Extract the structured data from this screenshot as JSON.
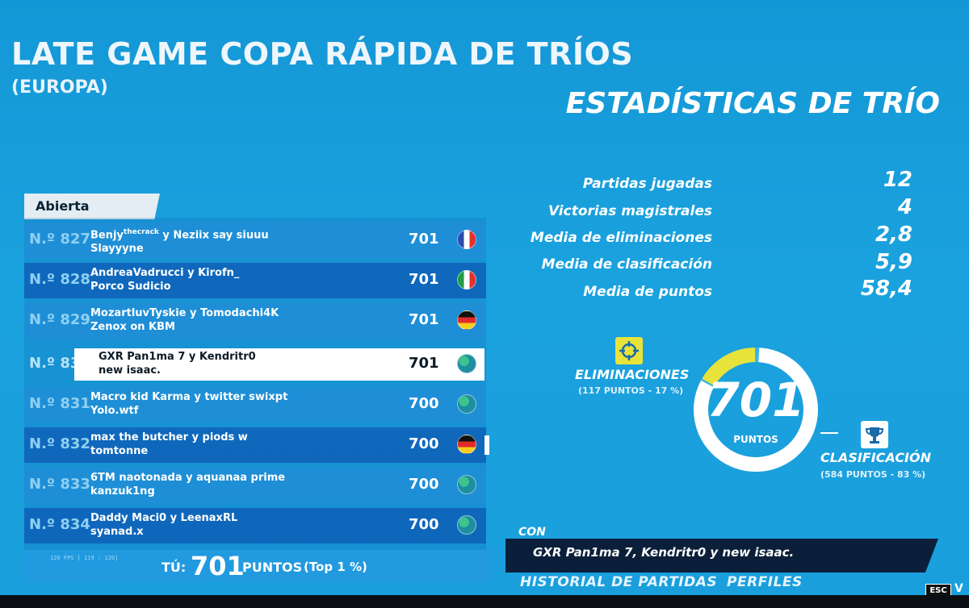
{
  "header": {
    "title": "LATE GAME COPA RÁPIDA DE TRÍOS",
    "region": "(EUROPA)",
    "stats_title": "ESTADÍSTICAS DE TRÍO"
  },
  "leaderboard": {
    "tab": "Abierta",
    "rows": [
      {
        "rank": "N.º 827",
        "line1_pre": "Benjy",
        "line1_sup": "thecrack",
        "line1_post": " y Neziix say siuuu",
        "line2": "Slayyyne",
        "points": "701",
        "flag": "france"
      },
      {
        "rank": "N.º 828",
        "line1": "AndreaVadrucci y Kirofn_",
        "line2": "Porco Sudicio",
        "points": "701",
        "flag": "italy"
      },
      {
        "rank": "N.º 829",
        "line1": "MozartluvTyskie y Tomodachi4K",
        "line2": "Zenox on KBM",
        "points": "701",
        "flag": "germany"
      },
      {
        "rank": "N.º 83",
        "line1": "GXR Pan1ma 7 y Kendritr0",
        "line2": "new isaac.",
        "points": "701",
        "flag": "globe",
        "selected": true
      },
      {
        "rank": "N.º 831",
        "line1": "Macro kid Karma y twitter swixpt",
        "line2": "Yolo.wtf",
        "points": "700",
        "flag": "globe"
      },
      {
        "rank": "N.º 832",
        "line1": "max the butcher y piods w",
        "line2": "tomtonne",
        "points": "700",
        "flag": "germany"
      },
      {
        "rank": "N.º 833",
        "line1": "6TM naotonada y aquanaa prime",
        "line2": "kanzuk1ng",
        "points": "700",
        "flag": "globe"
      },
      {
        "rank": "N.º 834",
        "line1": "Daddy Maci0 y LeenaxRL",
        "line2": "syanad.x",
        "points": "700",
        "flag": "globe"
      }
    ],
    "fps": "120 FPS [ 119 : 120]",
    "you_label": "TÚ:",
    "you_points": "701",
    "you_points_label": "PUNTOS",
    "you_top": "(Top 1 %)"
  },
  "stats": [
    {
      "label": "Partidas jugadas",
      "value": "12"
    },
    {
      "label": "Victorias magistrales",
      "value": "4"
    },
    {
      "label": "Media de eliminaciones",
      "value": "2,8"
    },
    {
      "label": "Media de clasificación",
      "value": "5,9"
    },
    {
      "label": "Media de puntos",
      "value": "58,4"
    }
  ],
  "breakdown": {
    "total": "701",
    "total_label": "PUNTOS",
    "eliminations_label": "ELIMINACIONES",
    "eliminations_detail": "(117 PUNTOS - 17 %)",
    "eliminations_fraction": 0.17,
    "placement_label": "CLASIFICACIÓN",
    "placement_detail": "(584 PUNTOS - 83 %)",
    "placement_fraction": 0.83
  },
  "teammates": {
    "tag": "CON",
    "names": "GXR Pan1ma 7, Kendritr0 y new isaac."
  },
  "nav": {
    "history": "HISTORIAL DE PARTIDAS",
    "profiles": "PERFILES",
    "esc": "ESC",
    "esc_action": "V"
  },
  "colors": {
    "background": "#1aa2de",
    "eliminations": "#e8e33a",
    "placement": "#ffffff"
  }
}
